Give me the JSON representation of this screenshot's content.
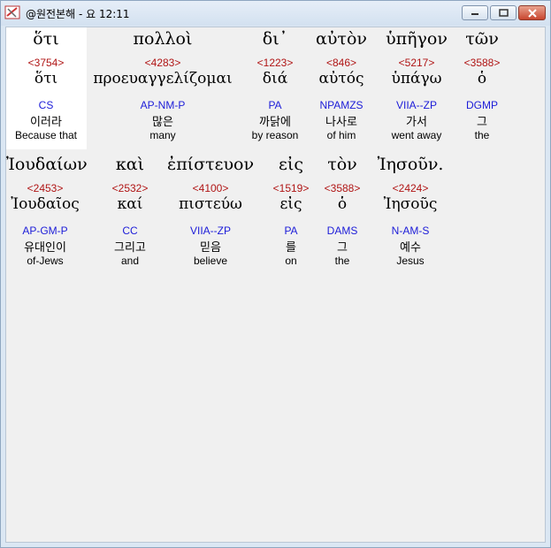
{
  "window": {
    "title": "@원전본해 - 요 12:11"
  },
  "rows": [
    {
      "words": [
        {
          "greek": "ὅτι",
          "strong": "<3754>",
          "lex": "ὅτι",
          "morph": "CS",
          "korean": "이러라",
          "english": "Because that"
        },
        {
          "greek": "πολλοὶ",
          "strong": "<4283>",
          "lex": "προευαγγελίζομαι",
          "morph": "AP-NM-P",
          "korean": "많은",
          "english": "many"
        },
        {
          "greek": "δι᾽",
          "strong": "<1223>",
          "lex": "διά",
          "morph": "PA",
          "korean": "까닭에",
          "english": "by reason"
        },
        {
          "greek": "αὐτὸν",
          "strong": "<846>",
          "lex": "αὐτός",
          "morph": "NPAMZS",
          "korean": "나사로",
          "english": "of him"
        },
        {
          "greek": "ὑπῆγον",
          "strong": "<5217>",
          "lex": "ὑπάγω",
          "morph": "VIIA--ZP",
          "korean": "가서",
          "english": "went away"
        },
        {
          "greek": "τῶν",
          "strong": "<3588>",
          "lex": "ὁ",
          "morph": "DGMP",
          "korean": "그",
          "english": "the"
        }
      ]
    },
    {
      "words": [
        {
          "greek": "Ἰουδαίων",
          "strong": "<2453>",
          "lex": "Ἰουδαῖος",
          "morph": "AP-GM-P",
          "korean": "유대인이",
          "english": "of-Jews"
        },
        {
          "greek": "καὶ",
          "strong": "<2532>",
          "lex": "καί",
          "morph": "CC",
          "korean": "그리고",
          "english": "and"
        },
        {
          "greek": "ἐπίστευον",
          "strong": "<4100>",
          "lex": "πιστεύω",
          "morph": "VIIA--ZP",
          "korean": "믿음",
          "english": "believe"
        },
        {
          "greek": "εἰς",
          "strong": "<1519>",
          "lex": "εἰς",
          "morph": "PA",
          "korean": "를",
          "english": "on"
        },
        {
          "greek": "τὸν",
          "strong": "<3588>",
          "lex": "ὁ",
          "morph": "DAMS",
          "korean": "그",
          "english": "the"
        },
        {
          "greek": "Ἰησοῦν.",
          "strong": "<2424>",
          "lex": "Ἰησοῦς",
          "morph": "N-AM-S",
          "korean": "예수",
          "english": "Jesus"
        }
      ]
    }
  ]
}
